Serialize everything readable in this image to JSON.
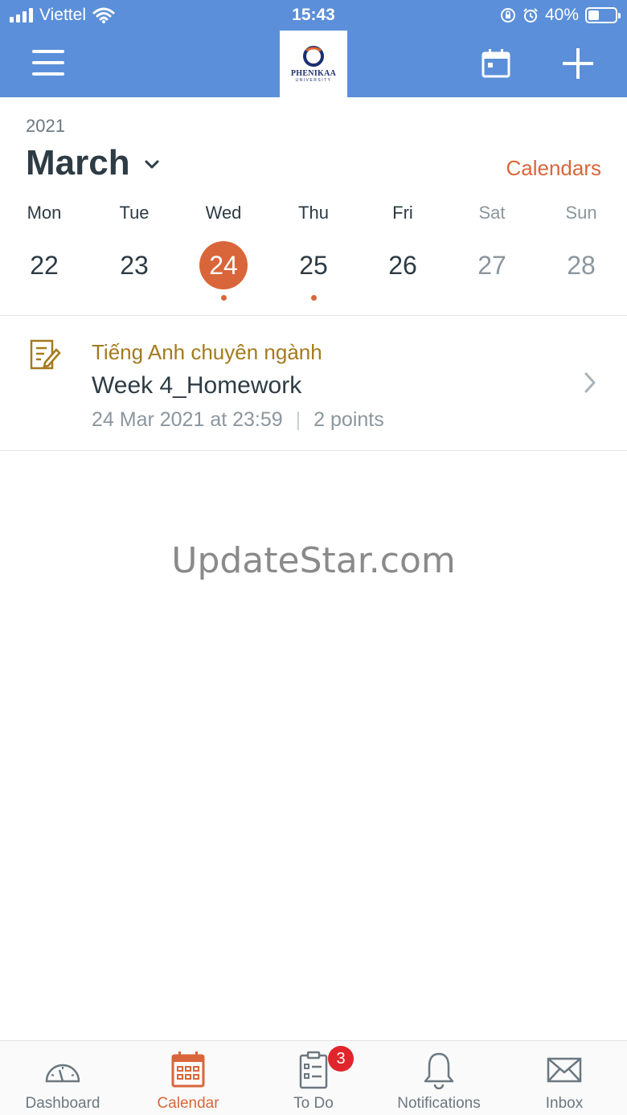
{
  "status_bar": {
    "carrier": "Viettel",
    "time": "15:43",
    "battery": "40%"
  },
  "header": {
    "logo_text": "PHENIKAA",
    "logo_subtext": "UNIVERSITY",
    "menu_icon": "hamburger-icon",
    "calendar_icon": "calendar-icon",
    "add_icon": "plus-icon"
  },
  "calendar": {
    "year": "2021",
    "month": "March",
    "calendars_link": "Calendars",
    "days": [
      {
        "name": "Mon",
        "num": "22",
        "weekend": false,
        "selected": false,
        "has_event": false
      },
      {
        "name": "Tue",
        "num": "23",
        "weekend": false,
        "selected": false,
        "has_event": false
      },
      {
        "name": "Wed",
        "num": "24",
        "weekend": false,
        "selected": true,
        "has_event": true
      },
      {
        "name": "Thu",
        "num": "25",
        "weekend": false,
        "selected": false,
        "has_event": true
      },
      {
        "name": "Fri",
        "num": "26",
        "weekend": false,
        "selected": false,
        "has_event": false
      },
      {
        "name": "Sat",
        "num": "27",
        "weekend": true,
        "selected": false,
        "has_event": false
      },
      {
        "name": "Sun",
        "num": "28",
        "weekend": true,
        "selected": false,
        "has_event": false
      }
    ]
  },
  "event": {
    "course": "Tiếng Anh chuyên ngành",
    "title": "Week 4_Homework",
    "due": "24 Mar 2021 at 23:59",
    "separator": "|",
    "points": "2 points"
  },
  "watermark": "UpdateStar.com",
  "tabs": [
    {
      "label": "Dashboard",
      "icon": "dashboard-icon",
      "active": false
    },
    {
      "label": "Calendar",
      "icon": "calendar-icon",
      "active": true
    },
    {
      "label": "To Do",
      "icon": "todo-icon",
      "active": false
    },
    {
      "label": "Notifications",
      "icon": "bell-icon",
      "active": false
    },
    {
      "label": "Inbox",
      "icon": "envelope-icon",
      "active": false
    }
  ],
  "todo_badge": "3",
  "colors": {
    "header_bg": "#5b8fd9",
    "accent": "#d9663a",
    "course": "#a47a1d",
    "badge": "#e0252c"
  }
}
